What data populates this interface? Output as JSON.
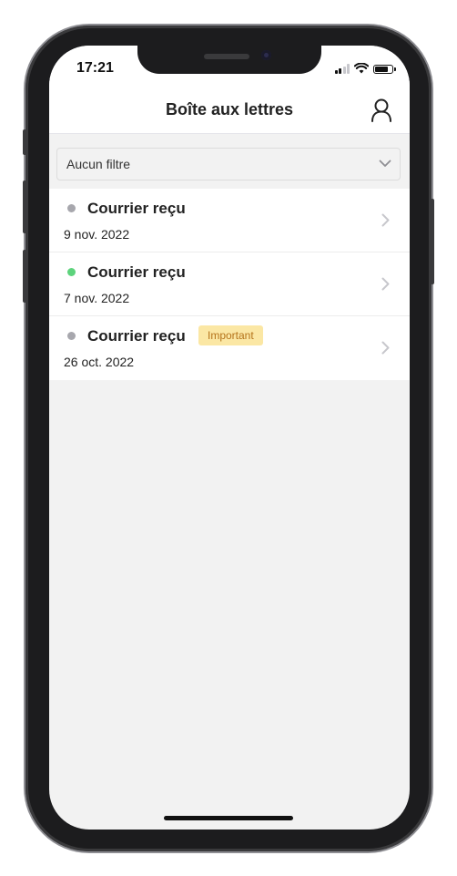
{
  "status_bar": {
    "time": "17:21",
    "icons": [
      "signal-icon",
      "wifi-icon",
      "battery-icon"
    ]
  },
  "header": {
    "title": "Boîte aux lettres",
    "profile_icon": "user-icon"
  },
  "filter": {
    "selected": "Aucun filtre",
    "icon": "chevron-down-icon"
  },
  "mail_items": [
    {
      "title": "Courrier reçu",
      "date": "9 nov. 2022",
      "status": "read",
      "badge": ""
    },
    {
      "title": "Courrier reçu",
      "date": "7 nov. 2022",
      "status": "unread",
      "badge": ""
    },
    {
      "title": "Courrier reçu",
      "date": "26 oct. 2022",
      "status": "read",
      "badge": "Important"
    }
  ],
  "colors": {
    "dot_read": "#a7a7ad",
    "dot_unread": "#5dd37c",
    "badge_bg": "#fbe7a4",
    "badge_text": "#b5741b",
    "background": "#f2f2f2"
  }
}
